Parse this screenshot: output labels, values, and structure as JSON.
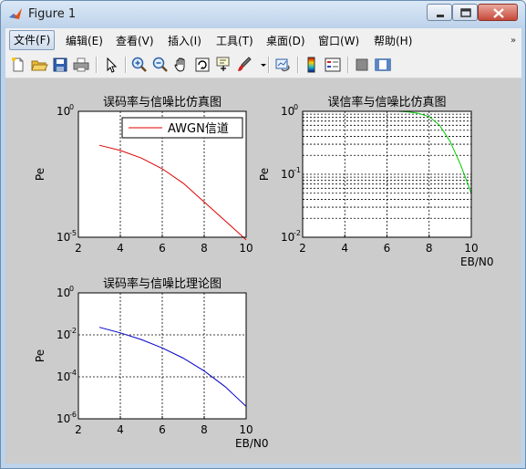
{
  "window": {
    "title": "Figure 1"
  },
  "menu": {
    "items": [
      {
        "label": "文件(F)"
      },
      {
        "label": "编辑(E)"
      },
      {
        "label": "查看(V)"
      },
      {
        "label": "插入(I)"
      },
      {
        "label": "工具(T)"
      },
      {
        "label": "桌面(D)"
      },
      {
        "label": "窗口(W)"
      },
      {
        "label": "帮助(H)"
      }
    ],
    "overflow_icon": "double-chevron-icon"
  },
  "toolbar": {
    "icons": [
      "new-figure-icon",
      "open-file-icon",
      "save-icon",
      "print-icon",
      "pointer-icon",
      "zoom-in-icon",
      "zoom-out-icon",
      "pan-hand-icon",
      "rotate-3d-icon",
      "data-cursor-icon",
      "brush-icon",
      "brush-dropdown-icon",
      "link-plot-icon",
      "colorbar-icon",
      "legend-icon",
      "hide-plot-tools-icon",
      "show-plot-tools-icon"
    ]
  },
  "colors": {
    "red_series": "#e00000",
    "green_series": "#00cc00",
    "blue_series": "#0000c8",
    "figure_bg": "#cccccc"
  },
  "chart_data": [
    {
      "type": "line",
      "title": "误码率与信噪比仿真图",
      "xlabel": "",
      "ylabel": "Pe",
      "xlim": [
        2,
        10
      ],
      "ylim": [
        1e-05,
        1
      ],
      "yscale": "log",
      "xticks": [
        "2",
        "4",
        "6",
        "8",
        "10"
      ],
      "yticks": [
        {
          "base": "10",
          "exp": "0"
        },
        {
          "base": "10",
          "exp": "-5"
        }
      ],
      "grid": "dashed major",
      "legend": {
        "position": "top-right",
        "entries": [
          "AWGN信道"
        ]
      },
      "series": [
        {
          "name": "AWGN信道",
          "color": "#e00000",
          "x": [
            3,
            4,
            5,
            6,
            7,
            8,
            9,
            10
          ],
          "y": [
            0.045,
            0.028,
            0.014,
            0.0052,
            0.0014,
            0.00025,
            4.5e-05,
            8e-06
          ]
        }
      ]
    },
    {
      "type": "line",
      "title": "误信率与信噪比仿真图",
      "xlabel": "EB/N0",
      "ylabel": "Pe",
      "xlim": [
        2,
        10
      ],
      "ylim": [
        0.01,
        1
      ],
      "yscale": "log",
      "xticks": [
        "2",
        "4",
        "6",
        "8",
        "10"
      ],
      "yticks": [
        {
          "base": "10",
          "exp": "0"
        },
        {
          "base": "10",
          "exp": "-1"
        },
        {
          "base": "10",
          "exp": "-2"
        }
      ],
      "grid": "dashed major and minor",
      "series": [
        {
          "color": "#00cc00",
          "x": [
            3,
            4,
            5,
            6,
            6.5,
            7,
            7.5,
            8,
            8.5,
            9,
            9.5,
            10
          ],
          "y": [
            1,
            1,
            1,
            1,
            1,
            0.98,
            0.93,
            0.82,
            0.6,
            0.33,
            0.14,
            0.05
          ]
        }
      ]
    },
    {
      "type": "line",
      "title": "误码率与信噪比理论图",
      "xlabel": "EB/N0",
      "ylabel": "Pe",
      "xlim": [
        2,
        10
      ],
      "ylim": [
        1e-06,
        1
      ],
      "yscale": "log",
      "xticks": [
        "2",
        "4",
        "6",
        "8",
        "10"
      ],
      "yticks": [
        {
          "base": "10",
          "exp": "0"
        },
        {
          "base": "10",
          "exp": "-2"
        },
        {
          "base": "10",
          "exp": "-4"
        },
        {
          "base": "10",
          "exp": "-6"
        }
      ],
      "grid": "dashed major",
      "series": [
        {
          "color": "#0000c8",
          "x": [
            3,
            4,
            5,
            6,
            7,
            8,
            9,
            10
          ],
          "y": [
            0.023,
            0.0125,
            0.006,
            0.0024,
            0.00078,
            0.00019,
            3.4e-05,
            3.9e-06
          ]
        }
      ]
    }
  ]
}
